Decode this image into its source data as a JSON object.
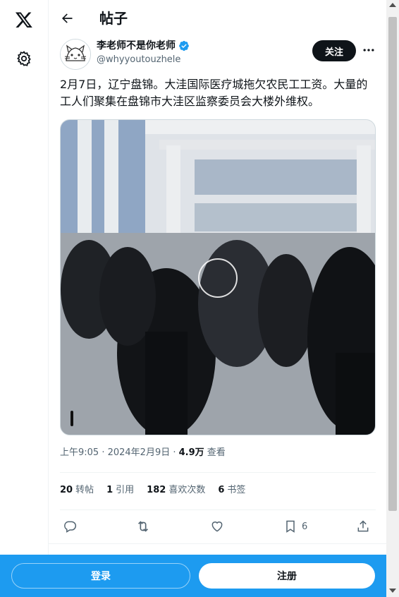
{
  "header": {
    "title": "帖子"
  },
  "author": {
    "name": "李老师不是你老师",
    "handle": "@whyyoutouzhele",
    "follow_label": "关注"
  },
  "post": {
    "text": "2月7日，辽宁盘锦。大洼国际医疗城拖欠农民工工资。大量的工人们聚集在盘锦市大洼区监察委员会大楼外维权。"
  },
  "meta": {
    "time": "上午9:05 · 2024年2月9日 · ",
    "views": "4.9万",
    "views_label": " 查看"
  },
  "stats": [
    {
      "value": "20",
      "label": "转帖"
    },
    {
      "value": "1",
      "label": "引用"
    },
    {
      "value": "182",
      "label": "喜欢次数"
    },
    {
      "value": "6",
      "label": "书签"
    }
  ],
  "actions": {
    "bookmark_count": "6"
  },
  "bottom_bar": {
    "login_label": "登录",
    "signup_label": "注册"
  },
  "icons": {
    "logo": "x-logo-icon",
    "settings": "gear-icon",
    "back": "back-arrow-icon",
    "verified": "verified-badge-icon",
    "more": "more-icon",
    "reply": "reply-icon",
    "repost": "repost-icon",
    "like": "like-icon",
    "bookmark": "bookmark-icon",
    "share": "share-icon",
    "play": "play-icon"
  },
  "colors": {
    "accent": "#1d9bf0",
    "text": "#0f1419",
    "secondary": "#536471"
  }
}
